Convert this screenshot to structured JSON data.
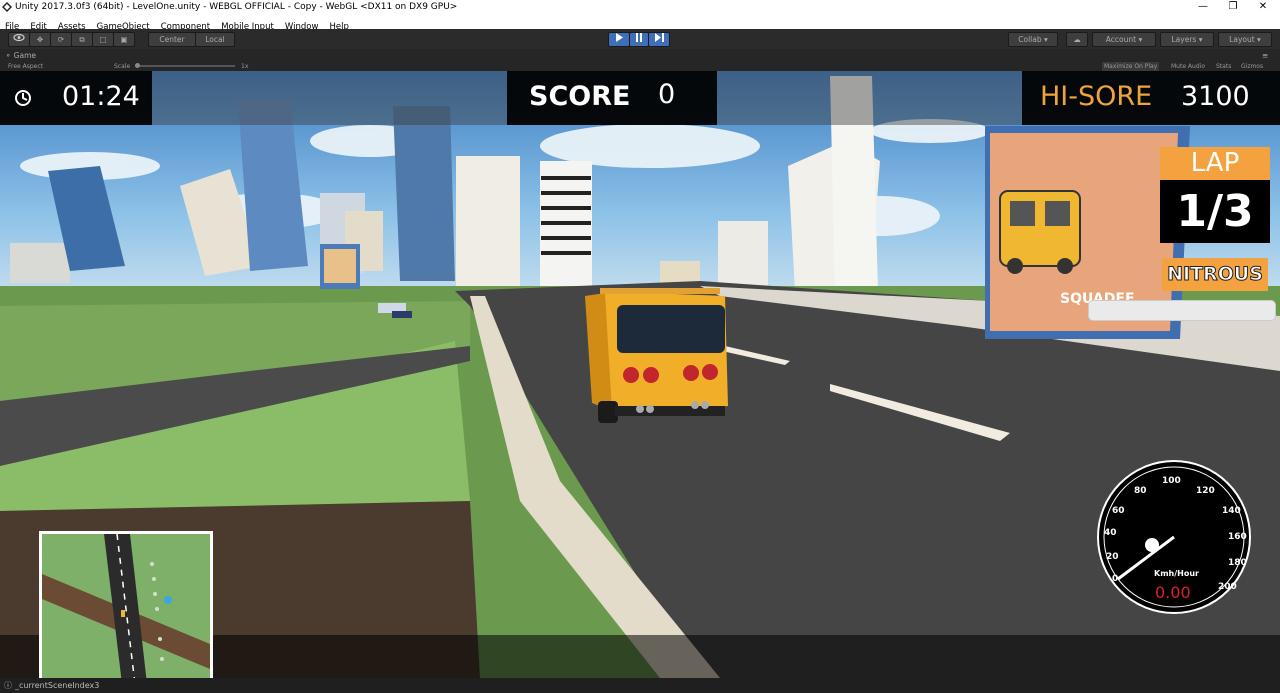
{
  "window": {
    "title": "Unity 2017.3.0f3 (64bit) - LevelOne.unity - WEBGL OFFICIAL - Copy - WebGL <DX11 on DX9 GPU>",
    "controls": [
      "—",
      "❐",
      "✕"
    ]
  },
  "menu": [
    "File",
    "Edit",
    "Assets",
    "GameObject",
    "Component",
    "Mobile Input",
    "Window",
    "Help"
  ],
  "toolbar": {
    "pivot": "Center",
    "space": "Local",
    "collab": "Collab ▾",
    "account": "Account",
    "layers": "Layers",
    "layout": "Layout"
  },
  "game_panel": {
    "tab": "Game",
    "aspect": "Free Aspect",
    "scale_label": "Scale",
    "scale_value": "1x",
    "options": [
      "Maximize On Play",
      "Mute Audio",
      "Stats",
      "Gizmos"
    ]
  },
  "hud": {
    "timer": "01:24",
    "score_label": "SCORE",
    "score_value": "0",
    "hiscore_label": "HI-SORE",
    "hiscore_value": "3100",
    "lap_label": "LAP",
    "lap_value": "1/3",
    "nitrous_label": "NITROUS",
    "speed_unit": "Kmh/Hour",
    "speed_value": "0.00",
    "speed_ticks": [
      "0",
      "20",
      "40",
      "60",
      "80",
      "100",
      "120",
      "140",
      "160",
      "180",
      "200"
    ],
    "billboard_text": "SQUADEE"
  },
  "status": {
    "message": "_currentSceneIndex3"
  },
  "colors": {
    "accent_orange": "#f3a23f",
    "speed_red": "#e02020",
    "editor_dark": "#2b2b2b"
  }
}
